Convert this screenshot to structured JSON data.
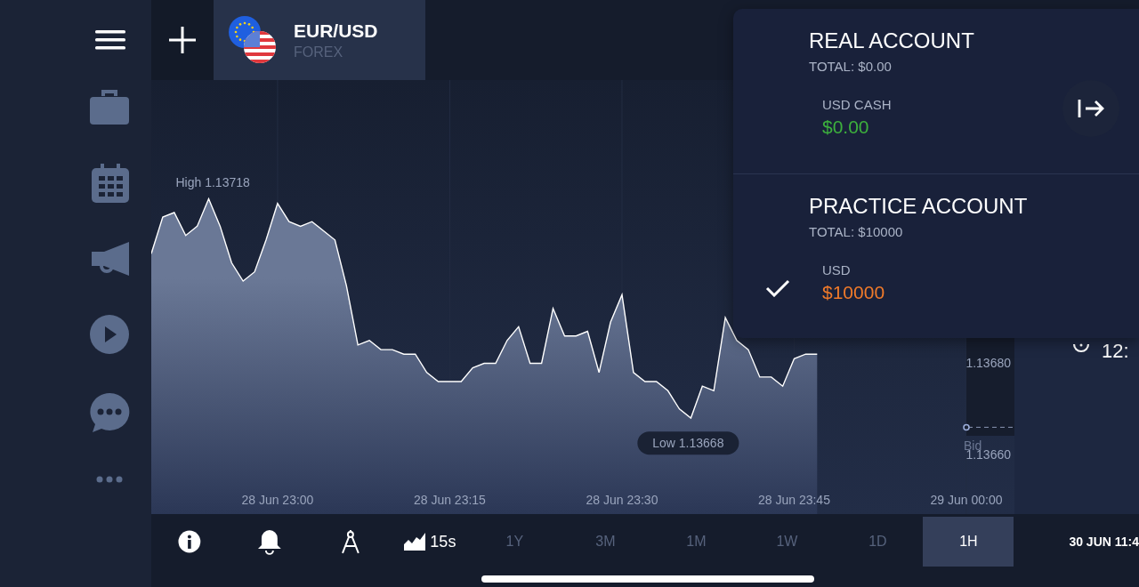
{
  "asset_tab": {
    "pair": "EUR/USD",
    "market": "FOREX"
  },
  "chart": {
    "clock_time": "12:",
    "high_label": "High 1.13718",
    "low_label": "Low 1.13668",
    "chart_data": {
      "type": "area",
      "categories": [
        null,
        null,
        null,
        null,
        null,
        null,
        null,
        null,
        null,
        null,
        null,
        "28 Jun 23:00",
        null,
        null,
        null,
        null,
        null,
        null,
        null,
        null,
        null,
        null,
        null,
        null,
        null,
        null,
        "28 Jun 23:15",
        null,
        null,
        null,
        null,
        null,
        null,
        null,
        null,
        null,
        null,
        null,
        null,
        null,
        null,
        "28 Jun 23:30",
        null,
        null,
        null,
        null,
        null,
        null,
        null,
        null,
        null,
        null,
        null,
        null,
        null,
        null,
        "28 Jun 23:45",
        null,
        null,
        null,
        null,
        null,
        null,
        null,
        null,
        null,
        null,
        null,
        null,
        null,
        null,
        "29 Jun 00:00"
      ],
      "series": [
        {
          "name": "Bid",
          "color": "#ffffff",
          "values": [
            1.13704,
            1.13712,
            1.13713,
            1.13708,
            1.1371,
            1.13716,
            1.1371,
            1.13702,
            1.13698,
            1.137,
            1.13707,
            1.13715,
            1.13711,
            1.1371,
            1.13711,
            1.13709,
            1.13707,
            1.13697,
            1.13684,
            1.13685,
            1.13683,
            1.13683,
            1.13682,
            1.13682,
            1.13678,
            1.13676,
            1.13676,
            1.13676,
            1.13679,
            1.1368,
            1.1368,
            1.13685,
            1.13688,
            1.1368,
            1.1368,
            1.13692,
            1.13686,
            1.13686,
            1.13687,
            1.13678,
            1.13689,
            1.13695,
            1.13678,
            1.13676,
            1.13676,
            1.13674,
            1.1367,
            1.13668,
            1.13675,
            1.13674,
            1.1369,
            1.13685,
            1.13683,
            1.13677,
            1.13677,
            1.13675,
            1.13681,
            1.13682,
            1.13682,
            null,
            null,
            null,
            null,
            null,
            null,
            null,
            null,
            null,
            null,
            null,
            null,
            null
          ]
        }
      ],
      "grid": true,
      "ylim": [
        1.13647,
        1.13742
      ],
      "yticks": [
        {
          "value": 1.1368,
          "label": "1.13680"
        },
        {
          "value": 1.1366,
          "label": "1.13660"
        }
      ]
    }
  },
  "accounts": [
    {
      "kind": "real",
      "title": "REAL ACCOUNT",
      "total": "TOTAL: $0.00",
      "currency": "USD CASH",
      "amount": "$0.00",
      "color": "#3db03d",
      "selected": false
    },
    {
      "kind": "practice",
      "title": "PRACTICE ACCOUNT",
      "total": "TOTAL: $10000",
      "currency": "USD",
      "amount": "$10000",
      "color": "#f07a2a",
      "selected": true
    }
  ],
  "toolbar": {
    "interval": "15s",
    "timeframes": [
      {
        "label": "1Y",
        "selected": false
      },
      {
        "label": "3M",
        "selected": false
      },
      {
        "label": "1M",
        "selected": false
      },
      {
        "label": "1W",
        "selected": false
      },
      {
        "label": "1D",
        "selected": false
      },
      {
        "label": "1H",
        "selected": true
      }
    ],
    "datetime": "30 JUN 11:4"
  }
}
